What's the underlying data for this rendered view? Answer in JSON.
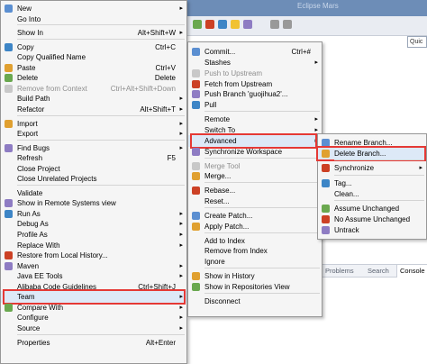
{
  "ide": {
    "window_title": "Eclipse Mars",
    "quick_access": "Quic",
    "tabs": [
      "Problems",
      "Search",
      "Console"
    ]
  },
  "context_menu": [
    {
      "label": "New",
      "shortcut": "",
      "submenu": true,
      "disabled": false
    },
    {
      "label": "Go Into",
      "shortcut": "",
      "submenu": false,
      "disabled": false
    },
    {
      "sep": true
    },
    {
      "label": "Show In",
      "shortcut": "Alt+Shift+W",
      "submenu": true,
      "disabled": false
    },
    {
      "sep": true
    },
    {
      "label": "Copy",
      "shortcut": "Ctrl+C",
      "submenu": false,
      "disabled": false
    },
    {
      "label": "Copy Qualified Name",
      "shortcut": "",
      "submenu": false,
      "disabled": false
    },
    {
      "label": "Paste",
      "shortcut": "Ctrl+V",
      "submenu": false,
      "disabled": false
    },
    {
      "label": "Delete",
      "shortcut": "Delete",
      "submenu": false,
      "disabled": false
    },
    {
      "label": "Remove from Context",
      "shortcut": "Ctrl+Alt+Shift+Down",
      "submenu": false,
      "disabled": true
    },
    {
      "label": "Build Path",
      "shortcut": "",
      "submenu": true,
      "disabled": false
    },
    {
      "label": "Refactor",
      "shortcut": "Alt+Shift+T",
      "submenu": true,
      "disabled": false
    },
    {
      "sep": true
    },
    {
      "label": "Import",
      "shortcut": "",
      "submenu": true,
      "disabled": false
    },
    {
      "label": "Export",
      "shortcut": "",
      "submenu": true,
      "disabled": false
    },
    {
      "sep": true
    },
    {
      "label": "Find Bugs",
      "shortcut": "",
      "submenu": true,
      "disabled": false
    },
    {
      "label": "Refresh",
      "shortcut": "F5",
      "submenu": false,
      "disabled": false
    },
    {
      "label": "Close Project",
      "shortcut": "",
      "submenu": false,
      "disabled": false
    },
    {
      "label": "Close Unrelated Projects",
      "shortcut": "",
      "submenu": false,
      "disabled": false
    },
    {
      "sep": true
    },
    {
      "label": "Validate",
      "shortcut": "",
      "submenu": false,
      "disabled": false
    },
    {
      "label": "Show in Remote Systems view",
      "shortcut": "",
      "submenu": false,
      "disabled": false
    },
    {
      "label": "Run As",
      "shortcut": "",
      "submenu": true,
      "disabled": false
    },
    {
      "label": "Debug As",
      "shortcut": "",
      "submenu": true,
      "disabled": false
    },
    {
      "label": "Profile As",
      "shortcut": "",
      "submenu": true,
      "disabled": false
    },
    {
      "label": "Replace With",
      "shortcut": "",
      "submenu": true,
      "disabled": false
    },
    {
      "label": "Restore from Local History...",
      "shortcut": "",
      "submenu": false,
      "disabled": false
    },
    {
      "label": "Maven",
      "shortcut": "",
      "submenu": true,
      "disabled": false
    },
    {
      "label": "Java EE Tools",
      "shortcut": "",
      "submenu": true,
      "disabled": false
    },
    {
      "label": "Alibaba Code Guidelines",
      "shortcut": "Ctrl+Shift+J",
      "submenu": false,
      "disabled": false
    },
    {
      "label": "Team",
      "shortcut": "",
      "submenu": true,
      "disabled": false,
      "selected": true
    },
    {
      "label": "Compare With",
      "shortcut": "",
      "submenu": true,
      "disabled": false
    },
    {
      "label": "Configure",
      "shortcut": "",
      "submenu": true,
      "disabled": false
    },
    {
      "label": "Source",
      "shortcut": "",
      "submenu": true,
      "disabled": false
    },
    {
      "sep": true
    },
    {
      "label": "Properties",
      "shortcut": "Alt+Enter",
      "submenu": false,
      "disabled": false
    }
  ],
  "team_menu": [
    {
      "label": "Commit...",
      "shortcut": "Ctrl+#",
      "submenu": false,
      "disabled": false
    },
    {
      "label": "Stashes",
      "shortcut": "",
      "submenu": true,
      "disabled": false
    },
    {
      "label": "Push to Upstream",
      "shortcut": "",
      "submenu": false,
      "disabled": true
    },
    {
      "label": "Fetch from Upstream",
      "shortcut": "",
      "submenu": false,
      "disabled": false
    },
    {
      "label": "Push Branch 'guojihua2'...",
      "shortcut": "",
      "submenu": false,
      "disabled": false
    },
    {
      "label": "Pull",
      "shortcut": "",
      "submenu": false,
      "disabled": false
    },
    {
      "sep": true
    },
    {
      "label": "Remote",
      "shortcut": "",
      "submenu": true,
      "disabled": false
    },
    {
      "label": "Switch To",
      "shortcut": "",
      "submenu": true,
      "disabled": false
    },
    {
      "label": "Advanced",
      "shortcut": "",
      "submenu": true,
      "disabled": false,
      "selected": true
    },
    {
      "label": "Synchronize Workspace",
      "shortcut": "",
      "submenu": false,
      "disabled": false
    },
    {
      "sep": true
    },
    {
      "label": "Merge Tool",
      "shortcut": "",
      "submenu": false,
      "disabled": true
    },
    {
      "label": "Merge...",
      "shortcut": "",
      "submenu": false,
      "disabled": false
    },
    {
      "sep": true
    },
    {
      "label": "Rebase...",
      "shortcut": "",
      "submenu": false,
      "disabled": false
    },
    {
      "label": "Reset...",
      "shortcut": "",
      "submenu": false,
      "disabled": false
    },
    {
      "sep": true
    },
    {
      "label": "Create Patch...",
      "shortcut": "",
      "submenu": false,
      "disabled": false
    },
    {
      "label": "Apply Patch...",
      "shortcut": "",
      "submenu": false,
      "disabled": false
    },
    {
      "sep": true
    },
    {
      "label": "Add to Index",
      "shortcut": "",
      "submenu": false,
      "disabled": false
    },
    {
      "label": "Remove from Index",
      "shortcut": "",
      "submenu": false,
      "disabled": false
    },
    {
      "label": "Ignore",
      "shortcut": "",
      "submenu": false,
      "disabled": false
    },
    {
      "sep": true
    },
    {
      "label": "Show in History",
      "shortcut": "",
      "submenu": false,
      "disabled": false
    },
    {
      "label": "Show in Repositories View",
      "shortcut": "",
      "submenu": false,
      "disabled": false
    },
    {
      "sep": true
    },
    {
      "label": "Disconnect",
      "shortcut": "",
      "submenu": false,
      "disabled": false
    }
  ],
  "advanced_menu": [
    {
      "label": "Rename Branch...",
      "shortcut": "",
      "submenu": false,
      "disabled": false
    },
    {
      "label": "Delete Branch...",
      "shortcut": "",
      "submenu": false,
      "disabled": false,
      "selected": true
    },
    {
      "sep": true
    },
    {
      "label": "Synchronize",
      "shortcut": "",
      "submenu": true,
      "disabled": false
    },
    {
      "sep": true
    },
    {
      "label": "Tag...",
      "shortcut": "",
      "submenu": false,
      "disabled": false
    },
    {
      "label": "Clean...",
      "shortcut": "",
      "submenu": false,
      "disabled": false
    },
    {
      "sep": true
    },
    {
      "label": "Assume Unchanged",
      "shortcut": "",
      "submenu": false,
      "disabled": false
    },
    {
      "label": "No Assume Unchanged",
      "shortcut": "",
      "submenu": false,
      "disabled": false
    },
    {
      "label": "Untrack",
      "shortcut": "",
      "submenu": false,
      "disabled": false
    }
  ],
  "colors": {
    "highlight_border": "#e53935",
    "menu_bg": "#f5f5f5",
    "selection_bg": "#dde9f7"
  }
}
